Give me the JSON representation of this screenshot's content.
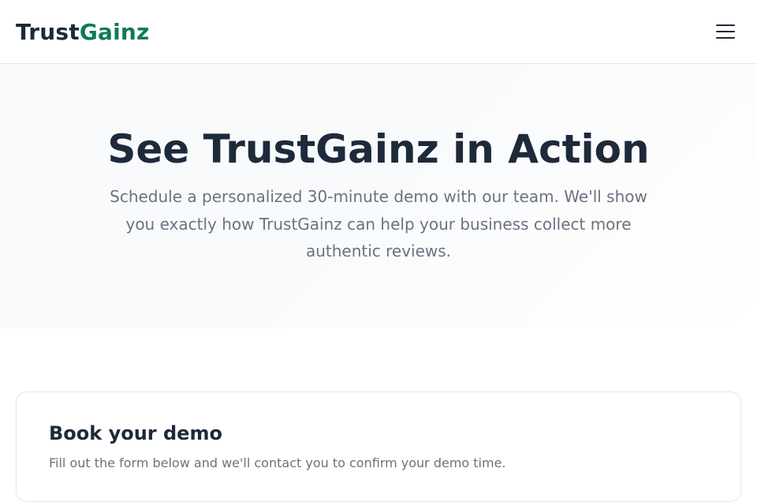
{
  "nav": {
    "logo_part1": "Trust",
    "logo_part2": "Gainz",
    "menu_icon": "hamburger-menu-icon"
  },
  "hero": {
    "title": "See TrustGainz in Action",
    "subtitle": "Schedule a personalized 30-minute demo with our team. We'll show you exactly how TrustGainz can help your business collect more authentic reviews."
  },
  "demo_card": {
    "title": "Book your demo",
    "subtitle": "Fill out the form below and we'll contact you to confirm your demo time."
  },
  "colors": {
    "brand_green": "#0f7b4f",
    "heading": "#1e293b",
    "muted_text": "#6b7280",
    "border": "#e5e7eb"
  }
}
